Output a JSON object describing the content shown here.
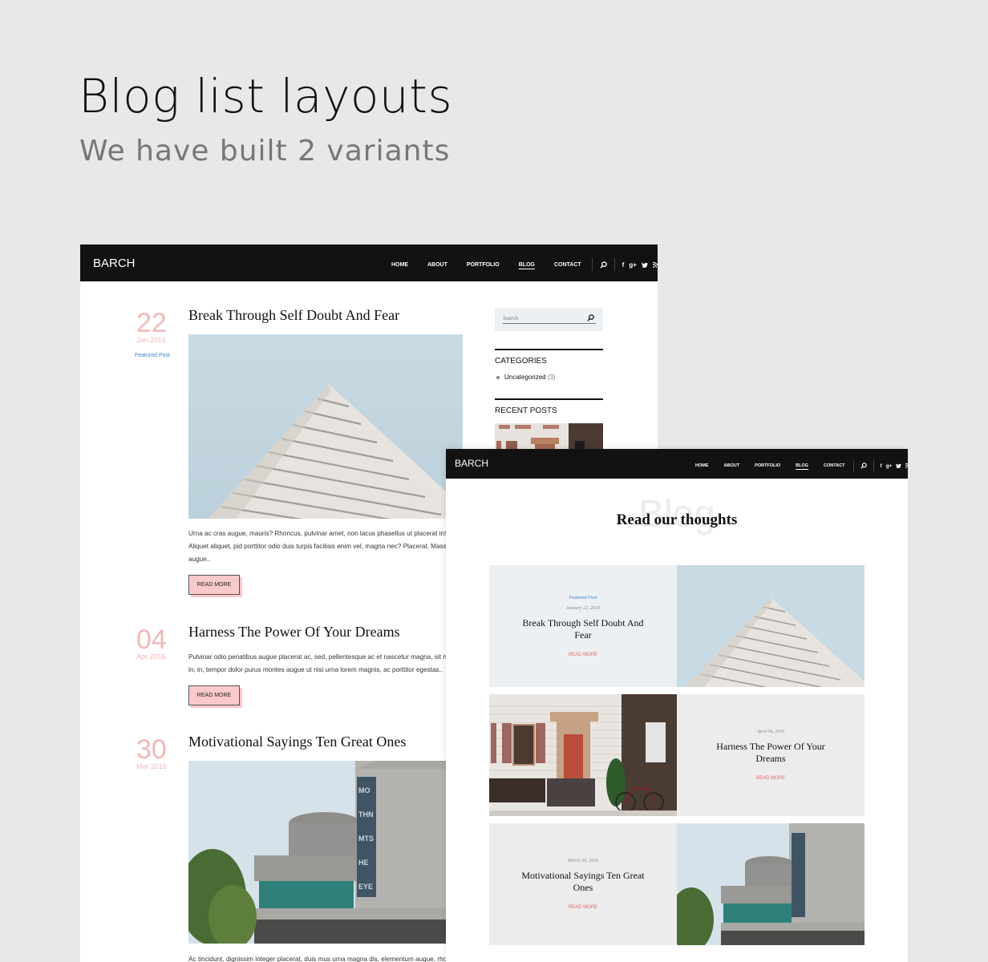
{
  "hero": {
    "title": "Blog list layouts",
    "subtitle": "We have built 2 variants"
  },
  "nav": {
    "brand": "BARCH",
    "items": [
      {
        "label": "HOME",
        "active": false
      },
      {
        "label": "ABOUT",
        "active": false
      },
      {
        "label": "PORTFOLIO",
        "active": false
      },
      {
        "label": "BLOG",
        "active": true
      },
      {
        "label": "CONTACT",
        "active": false
      }
    ],
    "icons": [
      "search-icon",
      "facebook-icon",
      "google-plus-icon",
      "twitter-icon",
      "rss-icon"
    ],
    "icon_glyphs": {
      "facebook": "f",
      "google_plus": "g+",
      "twitter": "t",
      "rss": "◔"
    }
  },
  "variant1": {
    "posts": [
      {
        "day": "22",
        "month_year": "Jan 2016",
        "featured_label": "Featured Post",
        "title": "Break Through Self Doubt And Fear",
        "excerpt_lines": [
          "Urna ac cras augue, mauris? Rhoncus, pulvinar amet, non lacus phasellus ut placerat in!",
          "Aliquet aliquet, pid porttitor odio duis turpis facilisis enim vel, magna nec? Placerat. Mass",
          "augue.."
        ],
        "read_more": "READ MORE"
      },
      {
        "day": "04",
        "month_year": "Apr 2016",
        "title": "Harness The Power Of Your Dreams",
        "excerpt_lines": [
          "Pulvinar odio penatibus augue placerat ac, sed, pellentesque ac et nascetur magna, sit nis",
          "in, in, tempor dolor purus montes augue ut nisi urna lorem magnis, ac porttitor egestas.."
        ],
        "read_more": "READ MORE"
      },
      {
        "day": "30",
        "month_year": "Mar 2016",
        "title": "Motivational Sayings Ten Great Ones",
        "excerpt_lines": [
          "Ac tincidunt, dignissim integer placerat, duis mus urna magna dis, elementum augue, rhor"
        ]
      }
    ],
    "sidebar": {
      "search_placeholder": "Search",
      "categories_title": "CATEGORIES",
      "categories": [
        {
          "name": "Uncategorized",
          "count": "(3)"
        }
      ],
      "recent_title": "RECENT POSTS"
    }
  },
  "variant2": {
    "bg_word": "Blog",
    "heading": "Read our thoughts",
    "cards": [
      {
        "featured_label": "Featured Post",
        "date": "January 22, 2016",
        "title": "Break Through Self Doubt And Fear",
        "read_more": "READ MORE",
        "image": "pyramid-building",
        "bg": "#edf0f3"
      },
      {
        "date": "April 04, 2016",
        "title": "Harness The Power Of Your Dreams",
        "read_more": "READ MORE",
        "image": "townhouse-door",
        "bg": "#ececec"
      },
      {
        "date": "March 30, 2016",
        "title": "Motivational Sayings Ten Great Ones",
        "read_more": "READ MORE",
        "image": "concrete-museum",
        "bg": "#ececec"
      }
    ]
  },
  "colors": {
    "page_bg": "#e8e8e8",
    "nav_bg": "#121212",
    "date_pink": "#f2b8b8",
    "button_pink": "#f9c9cc",
    "featured_blue": "#3f84c6",
    "read_more_red": "#e56b6b"
  }
}
